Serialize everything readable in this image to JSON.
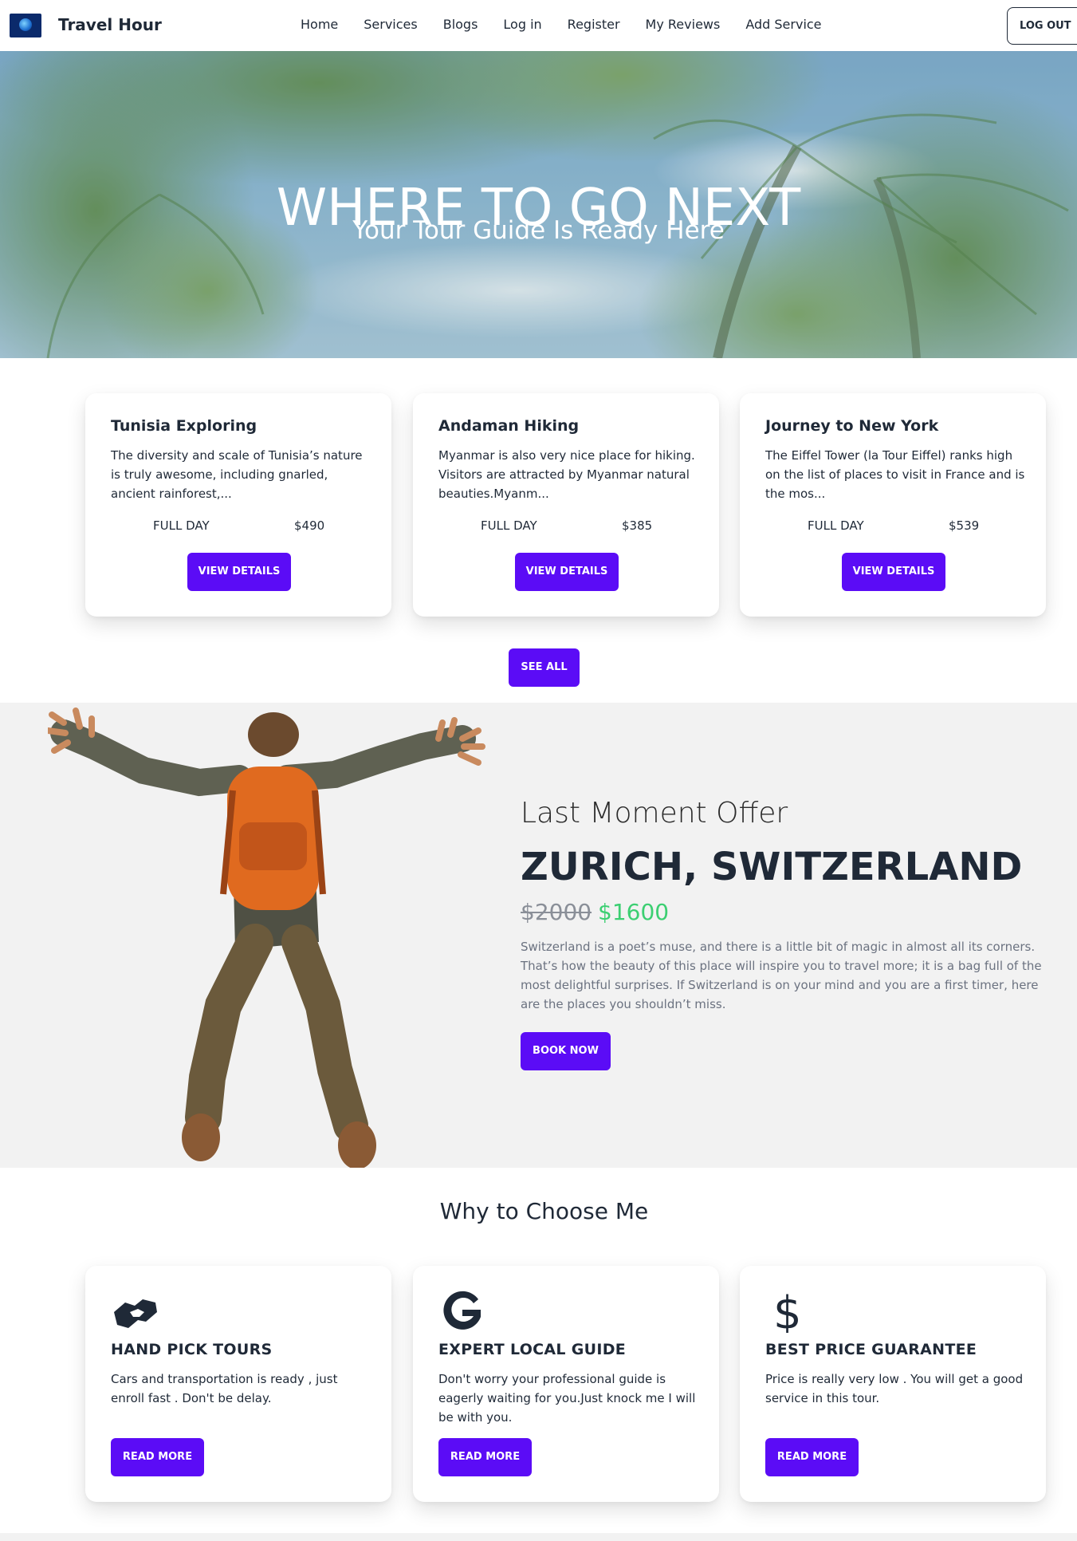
{
  "navbar": {
    "brand": "Travel Hour",
    "links": [
      "Home",
      "Services",
      "Blogs",
      "Log in",
      "Register",
      "My Reviews",
      "Add Service"
    ],
    "logout_label": "LOG OUT"
  },
  "hero": {
    "title": "WHERE TO GO NEXT",
    "subtitle": "Your Tour Guide Is Ready Here"
  },
  "services": [
    {
      "title": "Tunisia Exploring",
      "description": "The diversity and scale of Tunisia’s nature is truly awesome, including gnarled, ancient rainforest,...",
      "duration": "FULL DAY",
      "price": "$490",
      "button": "VIEW DETAILS"
    },
    {
      "title": "Andaman Hiking",
      "description": "Myanmar is also very nice place for hiking. Visitors are attracted by Myanmar natural beauties.Myanm...",
      "duration": "FULL DAY",
      "price": "$385",
      "button": "VIEW DETAILS"
    },
    {
      "title": "Journey to New York",
      "description": "The Eiffel Tower (la Tour Eiffel) ranks high on the list of places to visit in France and is the mos...",
      "duration": "FULL DAY",
      "price": "$539",
      "button": "VIEW DETAILS"
    }
  ],
  "see_all_label": "SEE ALL",
  "offer": {
    "subtitle": "Last Moment Offer",
    "title": "ZURICH, SWITZERLAND",
    "old_price": "$2000",
    "new_price": "$1600",
    "description": "Switzerland is a poet’s muse, and there is a little bit of magic in almost all its corners. That’s how the beauty of this place will inspire you to travel more; it is a bag full of the most delightful surprises. If Switzerland is on your mind and you are a first timer, here are the places you shouldn’t miss.",
    "button": "BOOK NOW"
  },
  "why": {
    "title": "Why to Choose Me",
    "cards": [
      {
        "icon": "handshake-icon",
        "title": "HAND PICK TOURS",
        "description": "Cars and transportation is ready , just enroll fast . Don't be delay.",
        "button": "READ MORE"
      },
      {
        "icon": "google-g-icon",
        "title": "EXPERT LOCAL GUIDE",
        "description": "Don't worry your professional guide is eagerly waiting for you.Just knock me I will be with you.",
        "button": "READ MORE"
      },
      {
        "icon": "dollar-icon",
        "title": "BEST PRICE GUARANTEE",
        "description": "Price is really very low . You will get a good service in this tour.",
        "button": "READ MORE"
      }
    ]
  },
  "colors": {
    "primary_button": "#5b0cf6",
    "new_price": "#3ccf72",
    "offer_bg": "#f2f2f2",
    "text_dark": "#1f2937"
  }
}
